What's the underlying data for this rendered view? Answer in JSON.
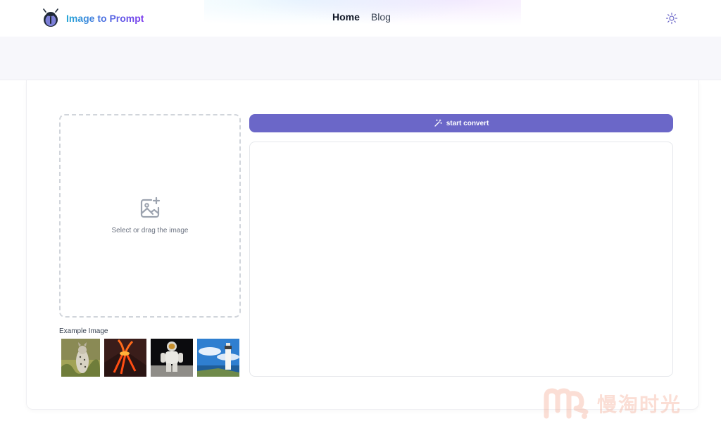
{
  "header": {
    "brand_name": "Image to Prompt",
    "logo_icon": "bug-logo-icon",
    "nav": [
      {
        "label": "Home",
        "active": true
      },
      {
        "label": "Blog",
        "active": false
      }
    ],
    "theme_toggle_icon": "sun-icon"
  },
  "upload": {
    "icon": "image-add-icon",
    "prompt": "Select or drag the image"
  },
  "examples": {
    "label": "Example Image",
    "images": [
      {
        "subject": "cat in grass"
      },
      {
        "subject": "erupting volcano"
      },
      {
        "subject": "astronaut on moon"
      },
      {
        "subject": "lighthouse by sea"
      }
    ]
  },
  "convert": {
    "label": "start convert",
    "icon": "magic-wand-icon"
  },
  "output": {
    "value": ""
  },
  "watermark": {
    "text": "慢淘时光"
  },
  "colors": {
    "accent": "#6b67c8",
    "brand_gradient_start": "#22a6d6",
    "brand_gradient_end": "#7c3aed",
    "watermark": "#f4a38a"
  }
}
